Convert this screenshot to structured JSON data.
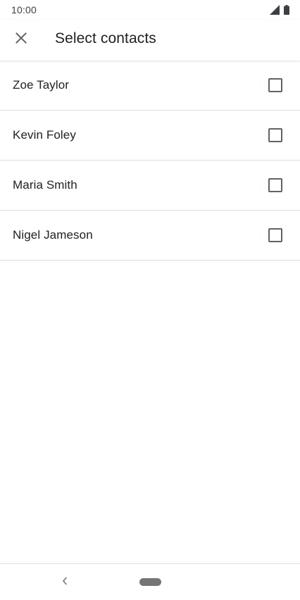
{
  "status_bar": {
    "time": "10:00",
    "icons": [
      "signal-icon",
      "battery-icon"
    ]
  },
  "app_bar": {
    "close_icon": "close-icon",
    "title": "Select contacts"
  },
  "contacts": [
    {
      "name": "Zoe Taylor",
      "checked": false
    },
    {
      "name": "Kevin Foley",
      "checked": false
    },
    {
      "name": "Maria Smith",
      "checked": false
    },
    {
      "name": "Nigel Jameson",
      "checked": false
    }
  ],
  "nav_bar": {
    "back_icon": "back-chevron-icon",
    "home_icon": "home-pill-icon"
  },
  "colors": {
    "text_primary": "#202124",
    "divider": "#dadce0",
    "checkbox_border": "#5f6368",
    "nav_pill": "#757575"
  }
}
